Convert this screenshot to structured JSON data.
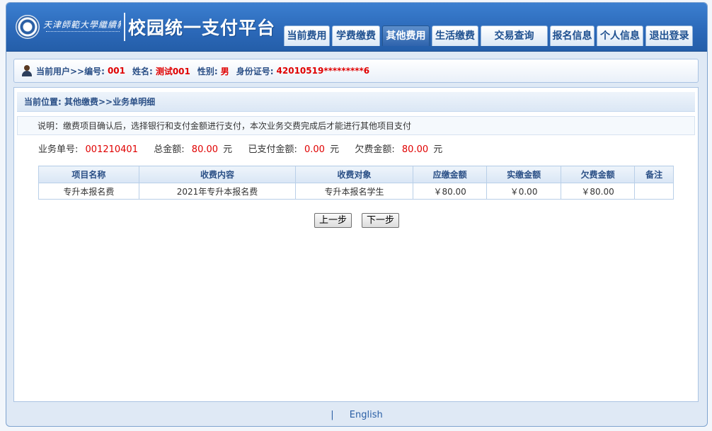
{
  "header": {
    "school_name_script": "天津師範大學繼續教育學院",
    "site_title": "校园统一支付平台",
    "nav": [
      {
        "label": "当前费用",
        "active": false
      },
      {
        "label": "学费缴费",
        "active": false
      },
      {
        "label": "其他费用",
        "active": true
      },
      {
        "label": "生活缴费",
        "active": false
      },
      {
        "label": "交易查询",
        "active": false
      },
      {
        "label": "报名信息",
        "active": false
      },
      {
        "label": "个人信息",
        "active": false
      },
      {
        "label": "退出登录",
        "active": false
      }
    ]
  },
  "user": {
    "prefix": "当前用户>>",
    "id_label": "编号:",
    "id_value": "001",
    "name_label": "姓名:",
    "name_value": "测试001",
    "gender_label": "性别:",
    "gender_value": "男",
    "idcard_label": "身份证号:",
    "idcard_value": "42010519*********6"
  },
  "breadcrumb": "当前位置: 其他缴费>>业务单明细",
  "note": "说明：缴费项目确认后，选择银行和支付金额进行支付，本次业务交费完成后才能进行其他项目支付",
  "summary": {
    "order_label": "业务单号:",
    "order_value": "001210401",
    "total_label": "总金额:",
    "total_value": "80.00",
    "paid_label": "已支付金额:",
    "paid_value": "0.00",
    "owed_label": "欠费金额:",
    "owed_value": "80.00",
    "unit": "元"
  },
  "table": {
    "headers": [
      "项目名称",
      "收费内容",
      "收费对象",
      "应缴金额",
      "实缴金额",
      "欠费金额",
      "备注"
    ],
    "rows": [
      [
        "专升本报名费",
        "2021年专升本报名费",
        "专升本报名学生",
        "￥80.00",
        "￥0.00",
        "￥80.00",
        ""
      ]
    ]
  },
  "buttons": {
    "prev": "上一步",
    "next": "下一步"
  },
  "footer": {
    "separator": "|",
    "english_link": "English"
  }
}
